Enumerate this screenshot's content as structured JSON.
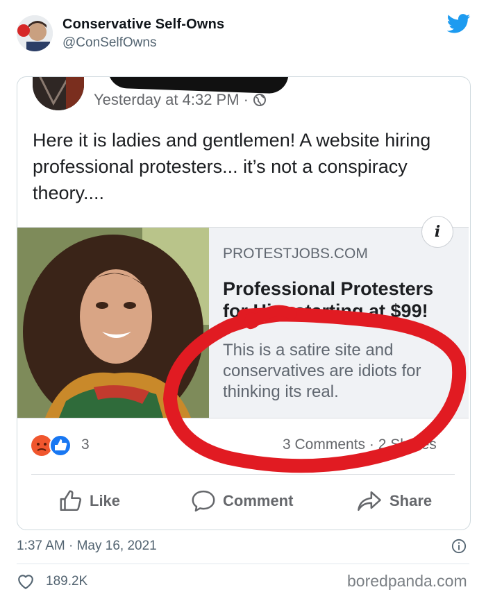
{
  "tweet": {
    "display_name": "Conservative Self-Owns",
    "handle": "@ConSelfOwns",
    "timestamp": "1:37 AM · May 16, 2021",
    "likes": "189.2K"
  },
  "facebook_post": {
    "time": "Yesterday at 4:32 PM · ",
    "text": "Here it is ladies and gentlemen! A website hiring professional protesters... it’s not a conspiracy theory....",
    "link": {
      "domain": "PROTESTJOBS.COM",
      "title": "Professional Protesters for Hire starting at $99!",
      "description": "This is a satire site and conservatives are idiots for thinking its real."
    },
    "reaction_count": "3",
    "stats": "3 Comments · 2 Shares",
    "actions": {
      "like": "Like",
      "comment": "Comment",
      "share": "Share"
    }
  },
  "watermark": "boredpanda.com",
  "colors": {
    "twitter_blue": "#1d9bf0",
    "red_marker": "#e11b22",
    "fb_blue": "#1877f2"
  }
}
